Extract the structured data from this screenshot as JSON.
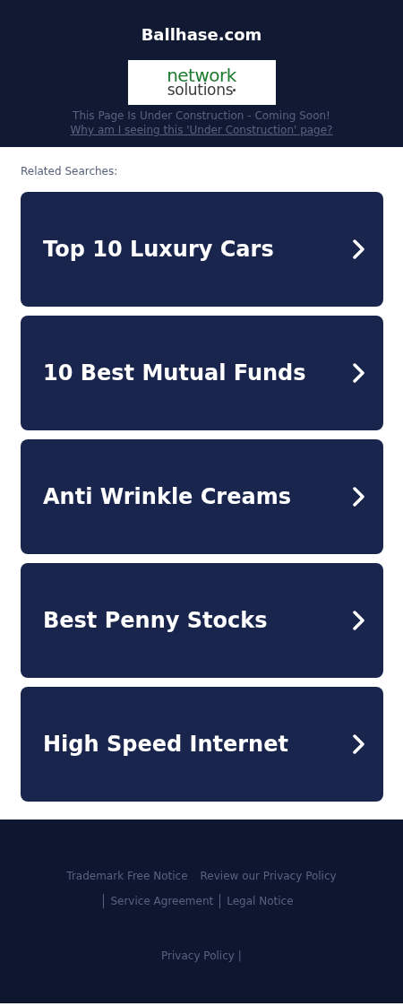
{
  "header": {
    "title": "Ballhase.com",
    "logo": {
      "line_1": "network",
      "line_2": "solutions"
    },
    "notice": "This Page Is Under Construction - Coming Soon!",
    "notice_link": "Why am I seeing this 'Under Construction' page?"
  },
  "related": {
    "heading": "Related Searches:",
    "items": [
      {
        "label": "Top 10 Luxury Cars"
      },
      {
        "label": "10 Best Mutual Funds"
      },
      {
        "label": "Anti Wrinkle Creams"
      },
      {
        "label": "Best Penny Stocks"
      },
      {
        "label": "High Speed Internet"
      }
    ]
  },
  "footer": {
    "links": [
      {
        "label": "Trademark Free Notice",
        "divider_before": false
      },
      {
        "label": "Review our Privacy Policy",
        "divider_before": false
      },
      {
        "label": "Service Agreement",
        "divider_before": true
      },
      {
        "label": "Legal Notice",
        "divider_before": true
      }
    ],
    "bottom_link": "Privacy Policy",
    "bottom_separator": "|"
  }
}
